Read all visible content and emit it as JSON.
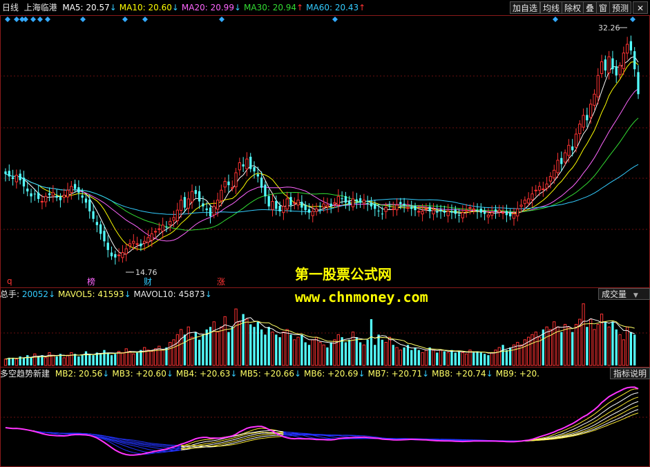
{
  "header": {
    "period": "日线",
    "stock_name": "上海临港",
    "ma": [
      {
        "label": "MA5",
        "value": "20.57",
        "arrow": "↓",
        "color": "#ffffff"
      },
      {
        "label": "MA10",
        "value": "20.60",
        "arrow": "↓",
        "color": "#ffff00"
      },
      {
        "label": "MA20",
        "value": "20.99",
        "arrow": "↓",
        "color": "#ff66ff"
      },
      {
        "label": "MA30",
        "value": "20.94",
        "arrow": "↑",
        "color": "#33dd33"
      },
      {
        "label": "MA60",
        "value": "20.43",
        "arrow": "↑",
        "color": "#33ccff"
      }
    ]
  },
  "toolbar": {
    "add_watch": "加自选",
    "avg_line": "均线",
    "ex_rights": "除权",
    "overlay": "叠",
    "window": "窗",
    "alert": "预测"
  },
  "price_panel": {
    "high_label": "32.26",
    "low_label": "14.76",
    "event_tags": [
      {
        "text": "q",
        "color": "#ff3333"
      },
      {
        "text": "榜",
        "color": "#ff66ff"
      },
      {
        "text": "财",
        "color": "#33ccff"
      },
      {
        "text": "涨",
        "color": "#ff3333"
      }
    ]
  },
  "watermark": {
    "line1": "第一股票公式网",
    "line2": "www.chnmoney.com"
  },
  "volume_panel": {
    "title": "总手",
    "total": "20052",
    "total_arrow": "↓",
    "mavol5_label": "MAVOL5",
    "mavol5": "41593",
    "mavol5_arrow": "↓",
    "mavol10_label": "MAVOL10",
    "mavol10": "45873",
    "mavol10_arrow": "↓",
    "selector": "成交量"
  },
  "indicator_panel": {
    "title": "多空趋势新建",
    "items": [
      {
        "label": "MB2",
        "value": "20.56",
        "arrow": "↓"
      },
      {
        "label": "MB3",
        "value": "+20.60",
        "arrow": "↓"
      },
      {
        "label": "MB4",
        "value": "+20.63",
        "arrow": "↓"
      },
      {
        "label": "MB5",
        "value": "+20.66",
        "arrow": "↓"
      },
      {
        "label": "MB6",
        "value": "+20.69",
        "arrow": "↓"
      },
      {
        "label": "MB7",
        "value": "+20.71",
        "arrow": "↓"
      },
      {
        "label": "MB8",
        "value": "+20.74",
        "arrow": "↓"
      },
      {
        "label": "MB9",
        "value": "+20.",
        "arrow": ""
      }
    ],
    "help": "指标说明"
  },
  "chart_data": [
    {
      "type": "candlestick",
      "title": "上海临港 日线",
      "ylim": [
        13.5,
        34
      ],
      "closes": [
        21.6,
        21.4,
        21.2,
        21.5,
        21.1,
        20.6,
        20.2,
        19.8,
        20.0,
        19.6,
        19.4,
        19.8,
        19.9,
        20.1,
        19.7,
        19.5,
        19.9,
        20.3,
        20.6,
        20.4,
        20.1,
        19.7,
        19.3,
        18.6,
        18.0,
        17.5,
        16.8,
        16.2,
        15.5,
        15.0,
        14.9,
        15.1,
        15.3,
        15.6,
        16.0,
        16.2,
        16.0,
        15.8,
        16.2,
        16.5,
        16.8,
        17.0,
        17.2,
        17.5,
        17.3,
        17.8,
        18.1,
        18.7,
        19.5,
        18.9,
        19.6,
        20.2,
        20.0,
        19.4,
        19.0,
        18.7,
        18.2,
        19.0,
        19.5,
        20.3,
        21.0,
        20.7,
        20.5,
        21.7,
        22.5,
        22.2,
        22.8,
        22.0,
        21.8,
        21.4,
        20.5,
        19.8,
        19.0,
        19.4,
        18.8,
        18.6,
        19.0,
        19.6,
        19.1,
        19.3,
        19.5,
        18.9,
        18.7,
        18.5,
        18.6,
        18.8,
        19.0,
        19.2,
        19.1,
        19.0,
        19.3,
        19.8,
        19.6,
        19.3,
        19.2,
        19.6,
        19.4,
        19.3,
        19.5,
        19.2,
        19.0,
        18.8,
        18.6,
        18.4,
        18.9,
        19.0,
        18.8,
        19.1,
        19.2,
        19.1,
        18.9,
        18.8,
        18.7,
        18.6,
        18.6,
        18.8,
        18.6,
        18.7,
        18.5,
        18.6,
        18.5,
        18.6,
        18.5,
        18.4,
        18.3,
        18.5,
        18.7,
        18.9,
        18.8,
        18.6,
        18.5,
        18.4,
        18.3,
        18.5,
        18.6,
        18.7,
        18.5,
        18.3,
        18.2,
        18.4,
        18.8,
        19.1,
        19.5,
        19.6,
        20.0,
        20.3,
        20.6,
        20.4,
        20.8,
        21.4,
        21.9,
        22.7,
        22.4,
        23.3,
        23.9,
        23.5,
        24.8,
        25.6,
        26.3,
        25.9,
        27.2,
        28.0,
        29.5,
        30.6,
        29.9,
        31.0,
        30.0,
        29.5,
        30.3,
        31.3,
        32.0,
        31.5,
        30.0,
        28.0
      ],
      "high": 32.26,
      "low": 14.76,
      "moving_averages": [
        "MA5",
        "MA10",
        "MA20",
        "MA30",
        "MA60"
      ]
    },
    {
      "type": "bar",
      "title": "成交量",
      "values": [
        5,
        6,
        6,
        5,
        7,
        6,
        8,
        6,
        9,
        7,
        8,
        6,
        10,
        8,
        7,
        9,
        6,
        8,
        10,
        9,
        7,
        8,
        11,
        9,
        8,
        10,
        9,
        12,
        10,
        8,
        9,
        11,
        10,
        13,
        11,
        9,
        10,
        12,
        14,
        12,
        11,
        13,
        15,
        12,
        14,
        18,
        20,
        24,
        28,
        24,
        30,
        22,
        26,
        20,
        24,
        28,
        30,
        34,
        26,
        30,
        38,
        26,
        30,
        44,
        34,
        40,
        36,
        32,
        30,
        34,
        28,
        24,
        30,
        26,
        24,
        22,
        26,
        28,
        24,
        20,
        22,
        24,
        18,
        16,
        20,
        22,
        18,
        16,
        14,
        18,
        20,
        24,
        22,
        18,
        20,
        26,
        22,
        18,
        16,
        20,
        36,
        16,
        24,
        20,
        18,
        22,
        16,
        14,
        12,
        14,
        16,
        12,
        14,
        12,
        10,
        12,
        14,
        12,
        10,
        12,
        11,
        10,
        12,
        10,
        11,
        10,
        9,
        12,
        10,
        11,
        10,
        9,
        8,
        10,
        12,
        14,
        16,
        12,
        14,
        16,
        18,
        16,
        20,
        22,
        24,
        26,
        22,
        28,
        30,
        28,
        34,
        30,
        26,
        32,
        30,
        26,
        32,
        36,
        48,
        30,
        36,
        28,
        32,
        40,
        34,
        30,
        34,
        28,
        24,
        20,
        30,
        26,
        24
      ],
      "ma_lines": [
        "MAVOL5",
        "MAVOL10"
      ]
    },
    {
      "type": "line",
      "title": "多空趋势新建",
      "series_count": 8
    }
  ]
}
